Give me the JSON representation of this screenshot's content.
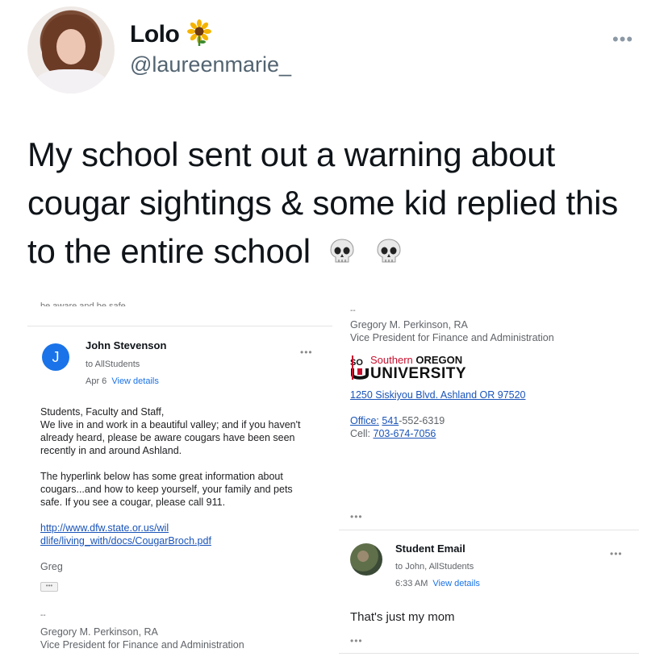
{
  "tweet": {
    "name": "Lolo",
    "handle": "@laureenmarie_",
    "more": "•••",
    "text": "My school sent out a warning about cougar sightings & some kid replied this to the entire school"
  },
  "left_email": {
    "cut_text": "be aware and be safe",
    "avatar_letter": "J",
    "sender": "John Stevenson",
    "to": "to AllStudents",
    "date": "Apr 6",
    "view_details": "View details",
    "more": "•••",
    "greeting": "Students, Faculty and Staff,",
    "body1": "We live in and work in a beautiful valley; and if you haven't already heard, please be aware cougars have been seen recently in and around Ashland.",
    "body2": "The hyperlink below has some great information about cougars...and how to keep yourself, your family and pets safe.  If you see a cougar, please call 911.",
    "link_line1": "http://www.dfw.state.or.us/wil",
    "link_line2": "dlife/living_with/docs/CougarBroch.pdf",
    "signoff": "Greg",
    "trimmed": "•••",
    "sig_dash": "--",
    "sig_name": "Gregory M. Perkinson, RA",
    "sig_title": "Vice President for Finance and Administration"
  },
  "right_email": {
    "sig_dash": "--",
    "sig_name": "Gregory M. Perkinson, RA",
    "sig_title": "Vice President for Finance and Administration",
    "logo_so": "SO",
    "logo_southern": "Southern",
    "logo_oregon": "OREGON",
    "logo_university": "UNIVERSITY",
    "address": "1250 Siskiyou Blvd. Ashland  OR 97520",
    "office_label": "Office:",
    "office_prefix": "541",
    "office_rest": "-552-6319",
    "cell_label": "Cell:",
    "cell_number": "703-674-7056",
    "trimmed": "•••"
  },
  "reply_email": {
    "sender": "Student Email",
    "to": "to John, AllStudents",
    "time": "6:33 AM",
    "view_details": "View details",
    "more": "•••",
    "body": "That's just my mom",
    "trimmed": "•••"
  },
  "colors": {
    "link": "#1a54b9",
    "avatar_blue": "#1a73e8",
    "sou_red": "#c8102e",
    "text_dark": "#0f1419",
    "handle_grey": "#536471"
  },
  "icons": [
    "sunflower-icon",
    "skull-icon",
    "more-icon"
  ]
}
